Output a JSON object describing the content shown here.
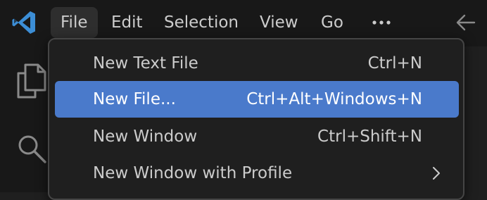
{
  "titlebar": {
    "logo_icon": "vscode-logo-icon",
    "menus": [
      {
        "label": "File",
        "active": true
      },
      {
        "label": "Edit"
      },
      {
        "label": "Selection"
      },
      {
        "label": "View"
      },
      {
        "label": "Go"
      }
    ],
    "more_icon": "ellipsis-icon",
    "back_icon": "arrow-left-icon"
  },
  "activitybar": {
    "items": [
      {
        "icon": "files-icon"
      },
      {
        "icon": "search-icon"
      }
    ]
  },
  "file_menu": {
    "items": [
      {
        "label": "New Text File",
        "shortcut": "Ctrl+N",
        "selected": false
      },
      {
        "label": "New File...",
        "shortcut": "Ctrl+Alt+Windows+N",
        "selected": true
      },
      {
        "label": "New Window",
        "shortcut": "Ctrl+Shift+N",
        "selected": false
      },
      {
        "label": "New Window with Profile",
        "shortcut": "",
        "submenu": true,
        "selected": false
      }
    ]
  },
  "colors": {
    "titlebar_bg": "#181818",
    "menu_bg": "#1f1f1f",
    "selection": "#4a7acb",
    "accent_logo": "#3c8ed6",
    "text": "#cccccc"
  }
}
